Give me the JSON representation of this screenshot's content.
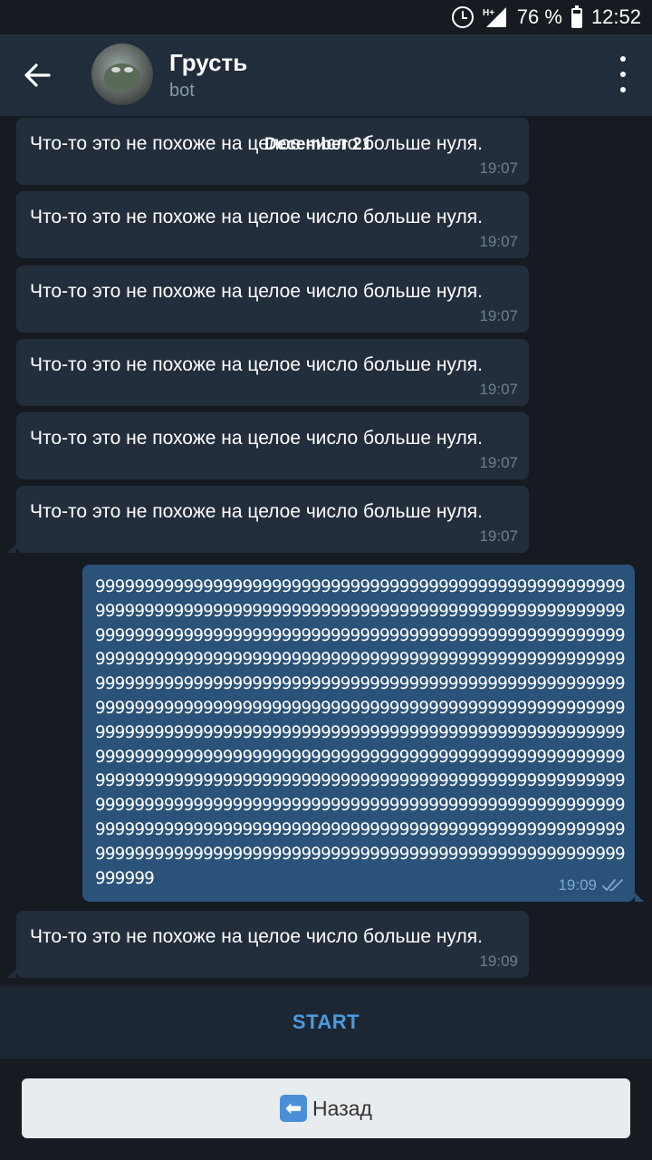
{
  "status_bar": {
    "network": "H+",
    "battery": "76 %",
    "time": "12:52",
    "icons": [
      "alarm-icon",
      "signal-icon",
      "battery-icon"
    ]
  },
  "header": {
    "title": "Грусть",
    "subtitle": "bot",
    "back_icon": "arrow-left-icon",
    "menu_icon": "more-vertical-icon"
  },
  "date_chip": "December 21",
  "messages": [
    {
      "text": "Что-то это не похоже на целое число больше нуля.",
      "time": "19:07",
      "direction": "in"
    },
    {
      "text": "Что-то это не похоже на целое число больше нуля.",
      "time": "19:07",
      "direction": "in"
    },
    {
      "text": "Что-то это не похоже на целое число больше нуля.",
      "time": "19:07",
      "direction": "in"
    },
    {
      "text": "Что-то это не похоже на целое число больше нуля.",
      "time": "19:07",
      "direction": "in"
    },
    {
      "text": "Что-то это не похоже на целое число больше нуля.",
      "time": "19:07",
      "direction": "in"
    },
    {
      "text": "Что-то это не похоже на целое число больше нуля.",
      "time": "19:07",
      "direction": "in"
    },
    {
      "text": "999999999999999999999999999999999999999999999999999999999999999999999999999999999999999999999999999999999999999999999999999999999999999999999999999999999999999999999999999999999999999999999999999999999999999999999999999999999999999999999999999999999999999999999999999999999999999999999999999999999999999999999999999999999999999999999999999999999999999999999999999999999999999999999999999999999999999999999999999999999999999999999999999999999999999999999999999999999999999999999999999999999999999999999999999999999999999999999999999999999999999999999999999999999999999999999999999999999999999999999999999999999999999999999999999999999999999999999999999999",
      "time": "19:09",
      "direction": "out",
      "status": "read-double-check-icon"
    },
    {
      "text": "Что-то это не похоже на целое число больше нуля.",
      "time": "19:09",
      "direction": "in"
    }
  ],
  "bot_start_label": "START",
  "keyboard": {
    "button_emoji": "⬅",
    "button_label": "Назад"
  },
  "colors": {
    "background": "#151b21",
    "header": "#212d3b",
    "incoming_bubble": "#232e3c",
    "outgoing_bubble": "#2b5278",
    "accent": "#4a9be0"
  }
}
